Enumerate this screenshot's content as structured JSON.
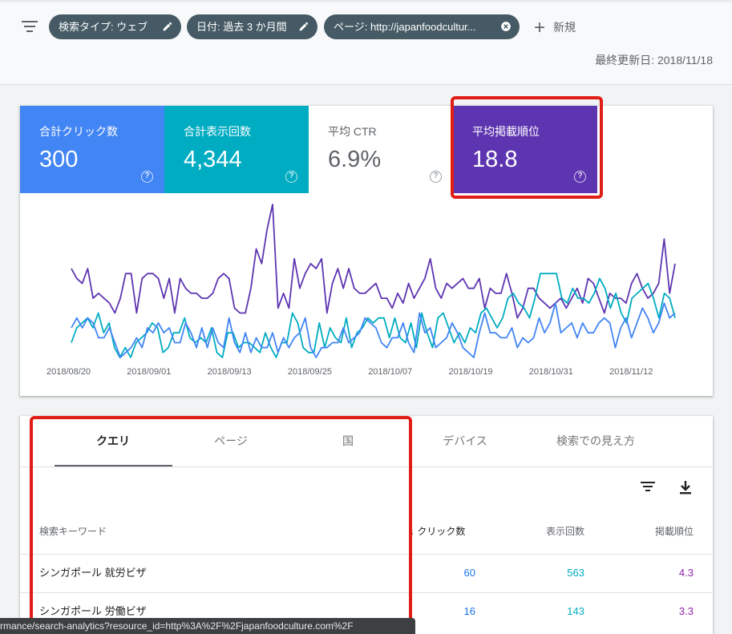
{
  "header": {
    "chips": [
      {
        "label": "検索タイプ: ウェブ",
        "icon": "pencil-icon"
      },
      {
        "label": "日付: 過去 3 か月間",
        "icon": "pencil-icon"
      },
      {
        "label": "ページ: http://japanfoodcultur...",
        "icon": "close-circle-icon"
      }
    ],
    "new_label": "新規",
    "updated": "最終更新日: 2018/11/18"
  },
  "metrics": {
    "clicks": {
      "label": "合計クリック数",
      "value": "300"
    },
    "impressions": {
      "label": "合計表示回数",
      "value": "4,344"
    },
    "ctr": {
      "label": "平均 CTR",
      "value": "6.9%"
    },
    "position": {
      "label": "平均掲載順位",
      "value": "18.8"
    },
    "help": "?"
  },
  "chart_data": {
    "type": "line",
    "x_tick_labels": [
      "2018/08/20",
      "2018/09/01",
      "2018/09/13",
      "2018/09/25",
      "2018/10/07",
      "2018/10/19",
      "2018/10/31",
      "2018/11/12"
    ],
    "series": [
      {
        "color": "#5e35b1",
        "values": [
          18,
          16,
          15,
          18,
          12,
          13,
          12,
          11,
          9,
          12,
          17,
          17,
          9,
          16,
          17,
          17,
          16,
          12,
          16,
          9,
          16,
          14,
          13,
          13,
          12,
          12,
          13,
          16,
          17,
          16,
          10,
          9,
          9,
          14,
          22,
          19,
          26,
          31,
          10,
          13,
          10,
          20,
          14,
          17,
          19,
          18,
          20,
          9,
          15,
          18,
          14,
          18,
          14,
          13,
          13,
          14,
          15,
          12,
          12,
          10,
          13,
          11,
          15,
          12,
          14,
          16,
          20,
          14,
          12,
          15,
          14,
          15,
          16,
          14,
          14,
          16,
          10,
          14,
          13,
          13,
          17,
          13,
          8,
          10,
          14,
          14,
          12,
          11,
          10,
          11,
          12,
          10,
          12,
          14,
          11,
          16,
          15,
          12,
          9,
          13,
          12,
          12,
          11,
          15,
          17,
          14,
          12,
          13,
          15,
          24,
          13,
          19
        ]
      },
      {
        "color": "#00acc1",
        "values": [
          3,
          6,
          7,
          8,
          6,
          9,
          5,
          7,
          2,
          0,
          2,
          0,
          3,
          4,
          5,
          7,
          6,
          1,
          2,
          5,
          5,
          8,
          4,
          3,
          4,
          3,
          6,
          1,
          0,
          5,
          5,
          2,
          3,
          3,
          2,
          1,
          5,
          2,
          0,
          3,
          3,
          9,
          7,
          2,
          1,
          1,
          7,
          2,
          6,
          4,
          3,
          8,
          2,
          5,
          6,
          8,
          7,
          8,
          8,
          4,
          8,
          4,
          3,
          7,
          2,
          9,
          5,
          2,
          8,
          9,
          6,
          3,
          5,
          3,
          6,
          5,
          9,
          10,
          8,
          6,
          8,
          12,
          13,
          11,
          10,
          8,
          12,
          17,
          17,
          17,
          17,
          12,
          11,
          14,
          12,
          12,
          11,
          13,
          16,
          14,
          10,
          13,
          9,
          7,
          12,
          13,
          14,
          15,
          12,
          8,
          13,
          12,
          8
        ]
      },
      {
        "color": "#4285f4",
        "values": [
          6,
          8,
          6,
          8,
          7,
          4,
          4,
          6,
          3,
          0,
          1,
          2,
          4,
          2,
          6,
          5,
          7,
          5,
          6,
          3,
          3,
          7,
          5,
          2,
          6,
          2,
          6,
          3,
          2,
          8,
          3,
          1,
          5,
          1,
          4,
          2,
          2,
          5,
          1,
          4,
          2,
          4,
          5,
          8,
          2,
          0,
          2,
          2,
          3,
          3,
          6,
          3,
          4,
          5,
          8,
          7,
          6,
          3,
          2,
          4,
          4,
          7,
          3,
          1,
          9,
          5,
          6,
          2,
          3,
          4,
          7,
          5,
          2,
          1,
          0,
          5,
          9,
          5,
          5,
          4,
          4,
          6,
          2,
          4,
          3,
          4,
          8,
          5,
          7,
          11,
          5,
          6,
          7,
          4,
          7,
          5,
          5,
          7,
          8,
          7,
          2,
          6,
          8,
          4,
          7,
          10,
          8,
          5,
          7,
          11,
          8,
          9
        ]
      }
    ],
    "legend": "none",
    "grid": false
  },
  "table": {
    "tabs": [
      "クエリ",
      "ページ",
      "国",
      "デバイス",
      "検索での見え方"
    ],
    "columns": {
      "keyword": "検索キーワード",
      "clicks": "クリック数",
      "impressions": "表示回数",
      "position": "掲載順位"
    },
    "rows": [
      {
        "keyword": "シンガポール 就労ビザ",
        "clicks": "60",
        "impressions": "563",
        "position": "4.3"
      },
      {
        "keyword": "シンガポール 労働ビザ",
        "clicks": "16",
        "impressions": "143",
        "position": "3.3"
      }
    ]
  },
  "status_url": "rmance/search-analytics?resource_id=http%3A%2F%2Fjapanfoodculture.com%2F"
}
